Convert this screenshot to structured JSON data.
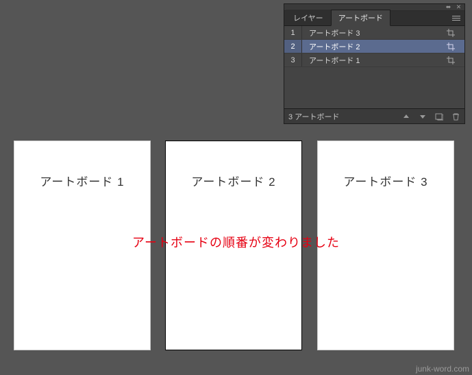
{
  "canvas": {
    "artboards": [
      {
        "label": "アートボード 1"
      },
      {
        "label": "アートボード 2"
      },
      {
        "label": "アートボード 3"
      }
    ],
    "annotation": "アートボードの順番が変わりました"
  },
  "panel": {
    "tabs": [
      {
        "label": "レイヤー",
        "active": false
      },
      {
        "label": "アートボード",
        "active": true
      }
    ],
    "rows": [
      {
        "num": "1",
        "name": "アートボード 3",
        "selected": false
      },
      {
        "num": "2",
        "name": "アートボード 2",
        "selected": true
      },
      {
        "num": "3",
        "name": "アートボード 1",
        "selected": false
      }
    ],
    "footer_label": "3 アートボード"
  },
  "watermark": "junk-word.com"
}
